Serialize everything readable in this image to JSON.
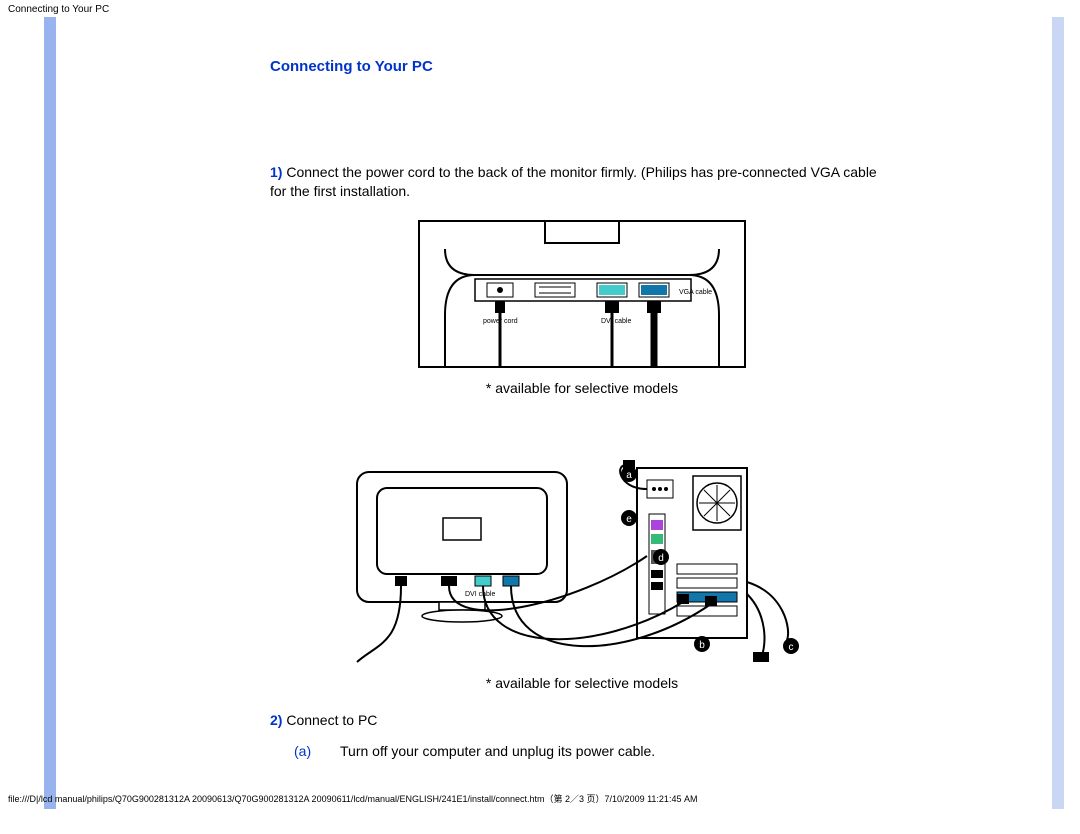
{
  "header_label": "Connecting to Your PC",
  "section_title": "Connecting to Your PC",
  "step1_num": "1)",
  "step1_text": " Connect the power cord to the back of the monitor firmly. (Philips has pre-connected VGA cable for the first installation.",
  "caption1": "* available for selective models",
  "caption2": "* available for selective models",
  "step2_num": "2)",
  "step2_text": " Connect to PC",
  "sub_a_letter": "(a)",
  "sub_a_text": "Turn off your computer and unplug its power cable.",
  "figure1_labels": {
    "power_cord": "power cord",
    "dvi_cable": "DVI cable",
    "vga_cable": "VGA cable"
  },
  "footer": "file:///D|/lcd manual/philips/Q70G900281312A 20090613/Q70G900281312A 20090611/lcd/manual/ENGLISH/241E1/install/connect.htm（第 2／3 页）7/10/2009 11:21:45 AM"
}
